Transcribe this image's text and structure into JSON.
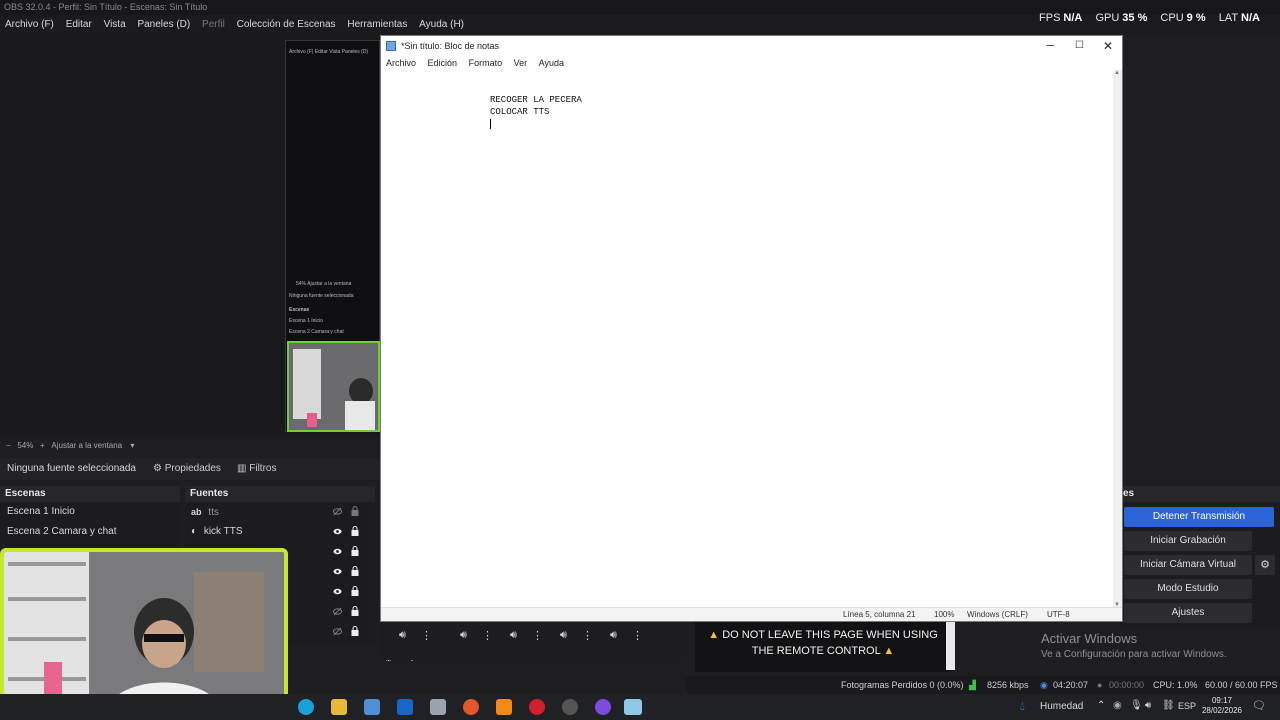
{
  "obs": {
    "title": "OBS 32.0.4 - Perfil: Sin Título - Escenas: Sin Título",
    "menu": [
      "Archivo (F)",
      "Editar",
      "Vista",
      "Paneles (D)",
      "Perfil",
      "Colección de Escenas",
      "Herramientas",
      "Ayuda (H)"
    ],
    "stats": {
      "fps_label": "FPS",
      "fps": "N/A",
      "gpu_label": "GPU",
      "gpu": "35 %",
      "cpu_label": "CPU",
      "cpu": "9 %",
      "lat_label": "LAT",
      "lat": "N/A"
    },
    "zoom": {
      "minus": "−",
      "value": "54%",
      "plus": "+",
      "mode": "Ajustar a la ventana"
    },
    "no_source": "Ninguna fuente seleccionada",
    "properties_btn": "Propiedades",
    "filters_btn": "Filtros",
    "scenes": {
      "title": "Escenas",
      "items": [
        "Escena 1 Inicio",
        "Escena 2 Camara y chat"
      ]
    },
    "sources": {
      "title": "Fuentes",
      "items": [
        "tts",
        "kick TTS"
      ]
    },
    "remote_banner": {
      "line1": "DO NOT LEAVE THIS PAGE WHEN USING",
      "line2": "THE REMOTE CONTROL"
    },
    "controls": {
      "title": "Controles",
      "stop_stream": "Detener Transmisión",
      "start_record": "Iniciar Grabación",
      "virtual_cam": "Iniciar Cámara Virtual",
      "studio_mode": "Modo Estudio",
      "settings": "Ajustes"
    },
    "status": {
      "dropped": "Fotogramas Perdidos 0 (0.0%)",
      "bitrate": "8256 kbps",
      "stream_time": "04:20:07",
      "record_time": "00:00:00",
      "cpu": "CPU: 1.0%",
      "fps": "60.00 / 60.00 FPS"
    },
    "mini": {
      "menu": "Archivo (F)  Editar  Vista  Paneles (D)",
      "zoom": "54%    Ajustar a la ventana",
      "no_source": "Ninguna fuente seleccionada",
      "scenes": "Escenas",
      "s1": "Escena 1 Inicio",
      "s2": "Escena 2 Camara y chat"
    }
  },
  "activate_windows": {
    "line1": "Activar Windows",
    "line2": "Ve a Configuración para activar Windows."
  },
  "notepad": {
    "title": "*Sin título: Bloc de notas",
    "menu": [
      "Archivo",
      "Edición",
      "Formato",
      "Ver",
      "Ayuda"
    ],
    "lines": [
      "RECOGER LA PECERA",
      "COLOCAR TTS"
    ],
    "status": {
      "position": "Línea 5, columna 21",
      "zoom": "100%",
      "eol": "Windows (CRLF)",
      "encoding": "UTF-8"
    }
  },
  "taskbar": {
    "weather": "Humedad",
    "lang": "ESP",
    "time": "09:17",
    "date": "28/02/2026"
  },
  "colors": {
    "accent": "#2a64d8",
    "webcam_border": "#c4e82b",
    "mini_cam_border": "#6fce3a"
  }
}
